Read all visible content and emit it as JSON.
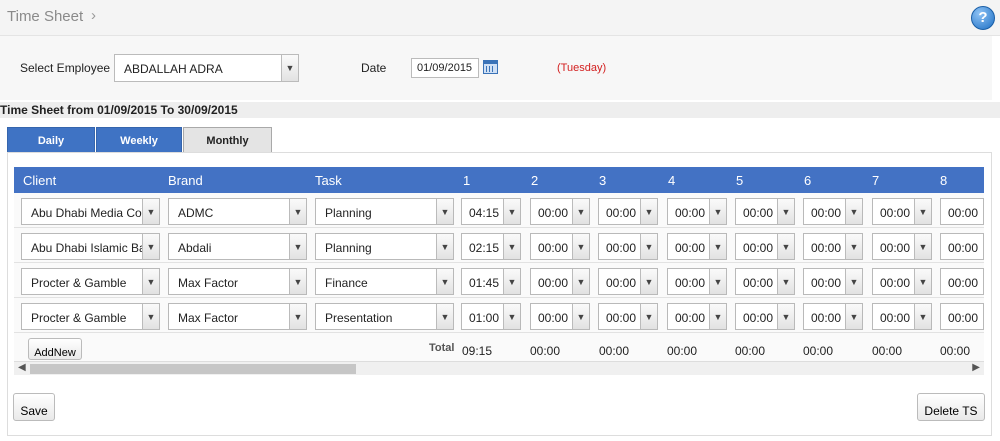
{
  "header": {
    "title": "Time Sheet",
    "chevron": "›",
    "help_icon": "help-icon"
  },
  "filter": {
    "employee_label": "Select Employee",
    "employee_value": "ABDALLAH ADRA",
    "date_label": "Date",
    "date_value": "01/09/2015",
    "day_name": "(Tuesday)"
  },
  "range_title": "Time Sheet from 01/09/2015 To 30/09/2015",
  "tabs": [
    {
      "label": "Daily"
    },
    {
      "label": "Weekly"
    },
    {
      "label": "Monthly"
    }
  ],
  "table": {
    "headers": [
      "Client",
      "Brand",
      "Task",
      "1",
      "2",
      "3",
      "4",
      "5",
      "6",
      "7",
      "8"
    ],
    "rows": [
      {
        "client": "Abu Dhabi Media Company",
        "brand": "ADMC",
        "task": "Planning",
        "hours": [
          "04:15",
          "00:00",
          "00:00",
          "00:00",
          "00:00",
          "00:00",
          "00:00",
          "00:00"
        ]
      },
      {
        "client": "Abu Dhabi Islamic Bank",
        "brand": "Abdali",
        "task": "Planning",
        "hours": [
          "02:15",
          "00:00",
          "00:00",
          "00:00",
          "00:00",
          "00:00",
          "00:00",
          "00:00"
        ]
      },
      {
        "client": "Procter & Gamble",
        "brand": "Max Factor",
        "task": "Finance",
        "hours": [
          "01:45",
          "00:00",
          "00:00",
          "00:00",
          "00:00",
          "00:00",
          "00:00",
          "00:00"
        ]
      },
      {
        "client": "Procter & Gamble",
        "brand": "Max Factor",
        "task": "Presentation",
        "hours": [
          "01:00",
          "00:00",
          "00:00",
          "00:00",
          "00:00",
          "00:00",
          "00:00",
          "00:00"
        ]
      }
    ],
    "total_label": "Total",
    "totals": [
      "09:15",
      "00:00",
      "00:00",
      "00:00",
      "00:00",
      "00:00",
      "00:00",
      "00:00"
    ]
  },
  "actions": {
    "add_new": "AddNew",
    "save": "Save",
    "delete": "Delete TS"
  },
  "colors": {
    "header_blue": "#4372c4",
    "day_red": "#d32020"
  }
}
